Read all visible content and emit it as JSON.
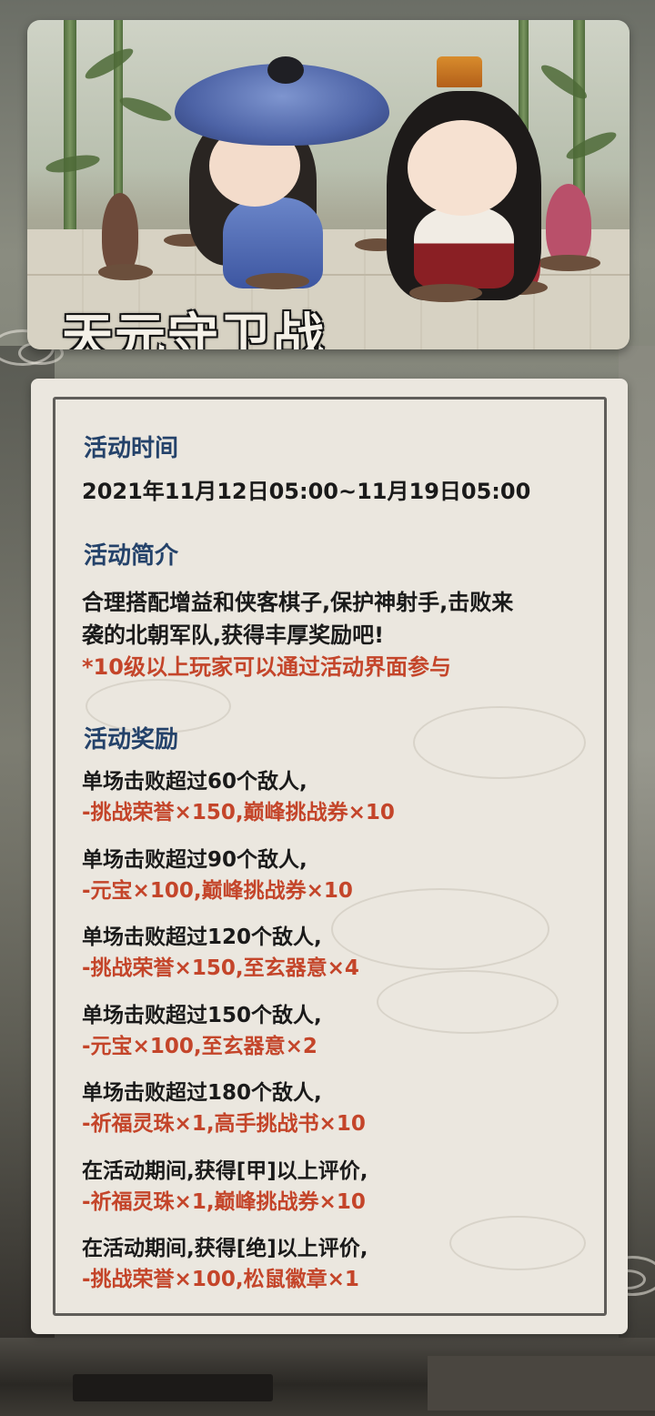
{
  "banner": {
    "title": "天元守卫战"
  },
  "sections": {
    "time": {
      "heading": "活动时间",
      "value": "2021年11月12日05:00~11月19日05:00"
    },
    "intro": {
      "heading": "活动简介",
      "line1": "合理搭配增益和侠客棋子,保护神射手,击败来",
      "line2": "袭的北朝军队,获得丰厚奖励吧!",
      "note": "*10级以上玩家可以通过活动界面参与"
    },
    "rewards": {
      "heading": "活动奖励",
      "items": [
        {
          "condition": "单场击败超过60个敌人,",
          "reward": "-挑战荣誉×150,巅峰挑战券×10"
        },
        {
          "condition": "单场击败超过90个敌人,",
          "reward": "-元宝×100,巅峰挑战券×10"
        },
        {
          "condition": "单场击败超过120个敌人,",
          "reward": "-挑战荣誉×150,至玄器意×4"
        },
        {
          "condition": "单场击败超过150个敌人,",
          "reward": "-元宝×100,至玄器意×2"
        },
        {
          "condition": "单场击败超过180个敌人,",
          "reward": "-祈福灵珠×1,高手挑战书×10"
        },
        {
          "condition": "在活动期间,获得[甲]以上评价,",
          "reward": "-祈福灵珠×1,巅峰挑战券×10"
        },
        {
          "condition": "在活动期间,获得[绝]以上评价,",
          "reward": "-挑战荣誉×100,松鼠徽章×1"
        }
      ]
    }
  },
  "colors": {
    "heading": "#24426a",
    "accent": "#c4452a",
    "text": "#1a1a1a",
    "card": "#ebe7df"
  }
}
